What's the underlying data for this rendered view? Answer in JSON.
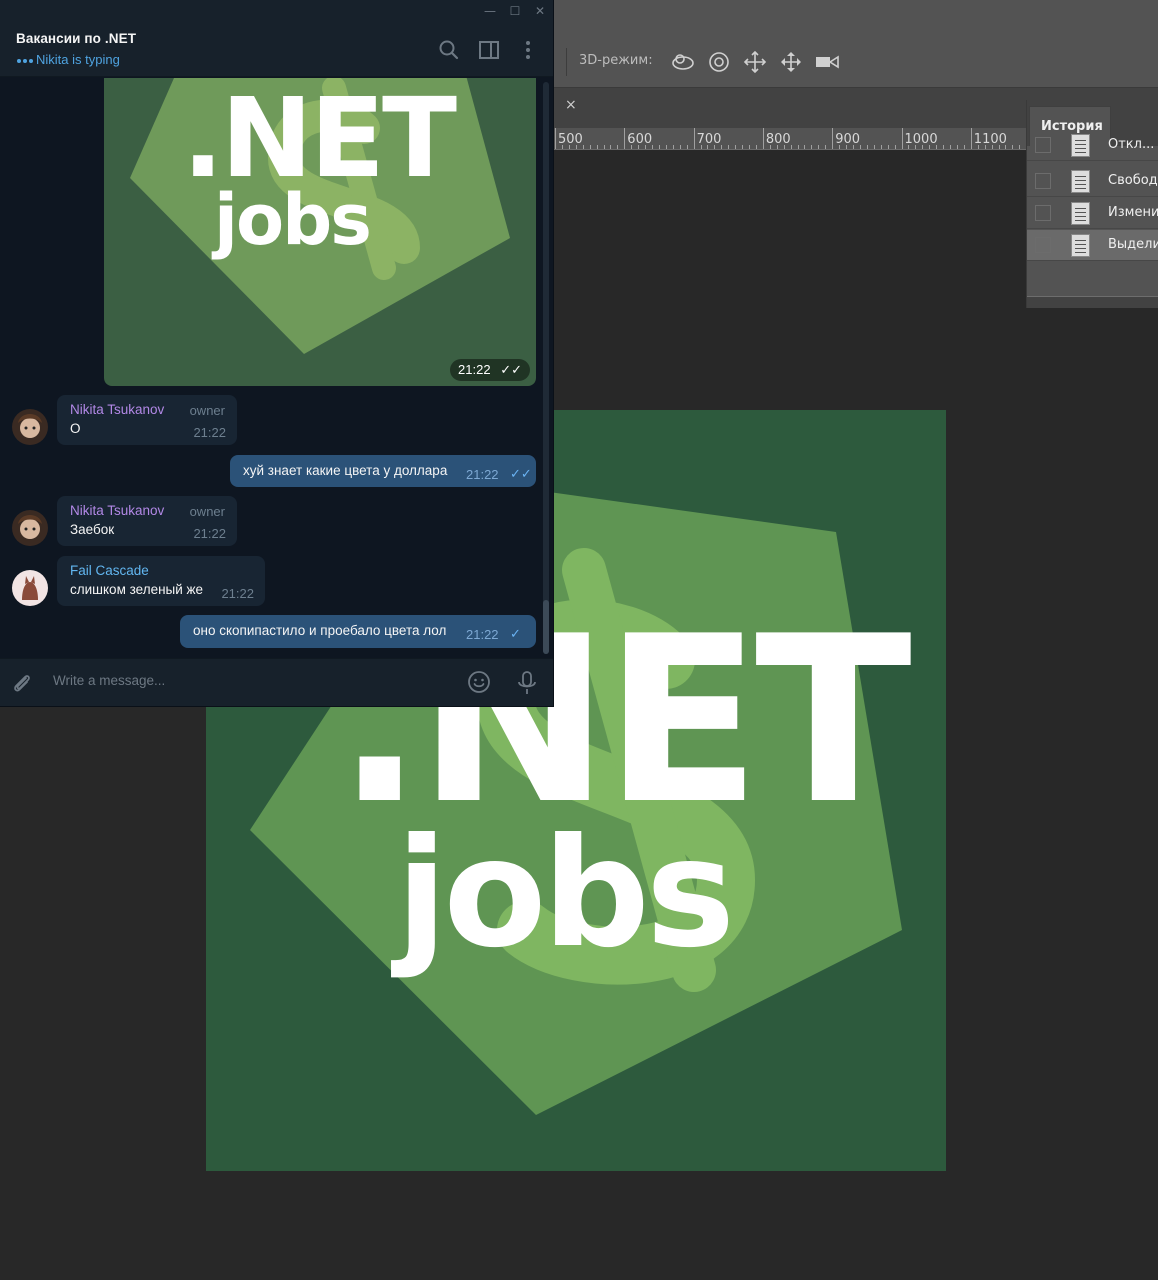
{
  "telegram": {
    "chat_title": "Вакансии по .NET",
    "typing_status": "Nikita is typing",
    "window_controls": {
      "minimize": "—",
      "maximize": "☐",
      "close": "✕"
    },
    "image_message": {
      "time": "21:22"
    },
    "messages": [
      {
        "sender": "Nikita Tsukanov",
        "role": "owner",
        "text": "О",
        "time": "21:22"
      },
      {
        "text": "хуй знает какие цвета у доллара",
        "time": "21:22"
      },
      {
        "sender": "Nikita Tsukanov",
        "role": "owner",
        "text": "Заебок",
        "time": "21:22"
      },
      {
        "sender": "Fail Cascade",
        "text": "слишком зеленый же",
        "time": "21:22"
      },
      {
        "text": "оно скопипастило и проебало цвета лол",
        "time": "21:22"
      }
    ],
    "composer": {
      "placeholder": "Write a message..."
    },
    "colors": {
      "background": "#0e1621",
      "header": "#17212b",
      "incoming_bubble": "#182533",
      "outgoing_bubble": "#2b5278",
      "accent": "#4fa3e0"
    }
  },
  "photoshop": {
    "options_bar": {
      "mode_label": "3D-режим:"
    },
    "tab_close": "×",
    "ruler_labels": [
      "500",
      "600",
      "700",
      "800",
      "900",
      "1000",
      "1100"
    ],
    "history_panel": {
      "tab_label": "История",
      "items": [
        {
          "label": "Откл..."
        },
        {
          "label": "Свобод"
        },
        {
          "label": "Изменит"
        },
        {
          "label": "Выделит"
        }
      ]
    },
    "canvas": {
      "logo_title": ".NET",
      "logo_subtitle": "jobs",
      "colors": {
        "background": "#2d5a3d",
        "pentagon": "#5f9553",
        "dollar": "#7fb661"
      }
    }
  }
}
